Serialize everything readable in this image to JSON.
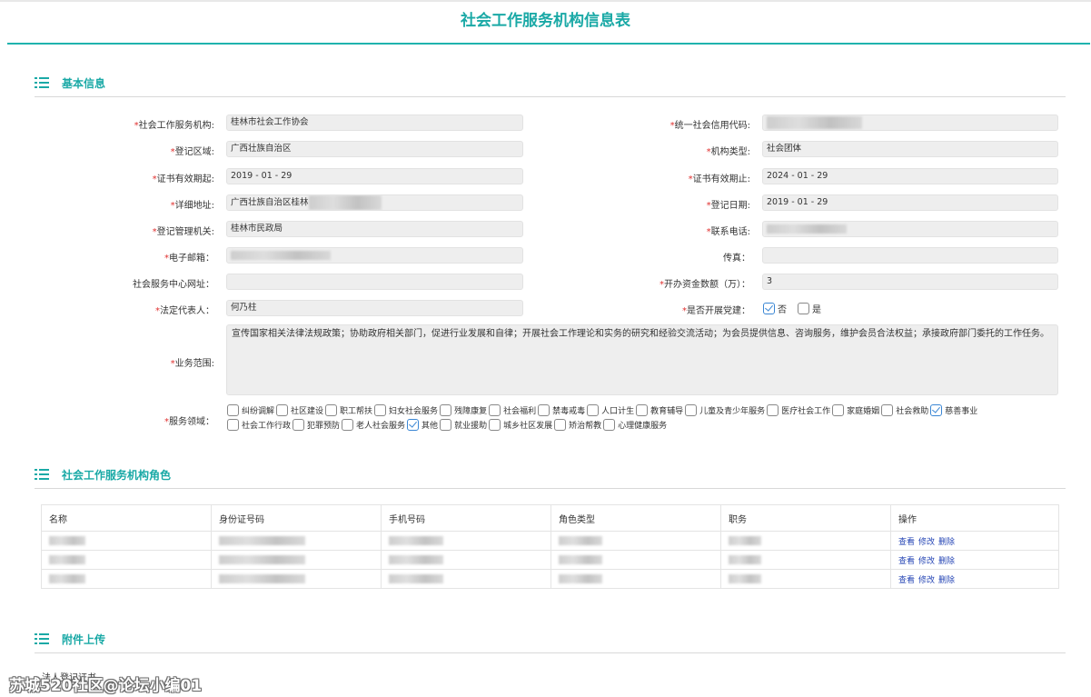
{
  "page": {
    "title": "社会工作服务机构信息表"
  },
  "sections": {
    "basic": "基本信息",
    "roles": "社会工作服务机构角色",
    "attachments": "附件上传"
  },
  "form": {
    "org_name": {
      "label": "社会工作服务机构:",
      "value": "桂林市社会工作协会"
    },
    "credit_code": {
      "label": "统一社会信用代码:",
      "value": ""
    },
    "region": {
      "label": "登记区域:",
      "value": "广西壮族自治区"
    },
    "org_type": {
      "label": "机构类型:",
      "value": "社会团体"
    },
    "cert_start": {
      "label": "证书有效期起:",
      "value": "2019 - 01 - 29"
    },
    "cert_end": {
      "label": "证书有效期止:",
      "value": "2024 - 01 - 29"
    },
    "address": {
      "label": "详细地址:",
      "value": "广西壮族自治区桂林"
    },
    "reg_date": {
      "label": "登记日期:",
      "value": "2019 - 01 - 29"
    },
    "authority": {
      "label": "登记管理机关:",
      "value": "桂林市民政局"
    },
    "phone": {
      "label": "联系电话:",
      "value": ""
    },
    "email": {
      "label": "电子邮箱：",
      "value": ""
    },
    "fax": {
      "label": "传真：",
      "value": ""
    },
    "website": {
      "label": "社会服务中心网址：",
      "value": ""
    },
    "capital": {
      "label": "开办资金数额（万）：",
      "value": "3"
    },
    "legal_rep": {
      "label": "法定代表人：",
      "value": "何乃柱"
    },
    "party": {
      "label": "是否开展党建：",
      "opt_no": "否",
      "opt_yes": "是",
      "selected": "否"
    },
    "scope": {
      "label": "业务范围:",
      "value": "宣传国家相关法律法规政策；协助政府相关部门，促进行业发展和自律；开展社会工作理论和实务的研究和经验交流活动；为会员提供信息、咨询服务，维护会员合法权益；承接政府部门委托的工作任务。"
    },
    "service_label": "服务领域：",
    "service_line1": [
      {
        "text": "纠纷调解",
        "checked": false
      },
      {
        "text": "社区建设",
        "checked": false
      },
      {
        "text": "职工帮扶",
        "checked": false
      },
      {
        "text": "妇女社会服务",
        "checked": false
      },
      {
        "text": "残障康复",
        "checked": false
      },
      {
        "text": "社会福利",
        "checked": false
      },
      {
        "text": "禁毒戒毒",
        "checked": false
      },
      {
        "text": "人口计生",
        "checked": false
      },
      {
        "text": "教育辅导",
        "checked": false
      },
      {
        "text": "儿童及青少年服务",
        "checked": false
      },
      {
        "text": "医疗社会工作",
        "checked": false
      },
      {
        "text": "家庭婚姻",
        "checked": false
      },
      {
        "text": "社会救助",
        "checked": false
      },
      {
        "text": "慈善事业",
        "checked": true
      }
    ],
    "service_line2": [
      {
        "text": "社会工作行政",
        "checked": false
      },
      {
        "text": "犯罪预防",
        "checked": false
      },
      {
        "text": "老人社会服务",
        "checked": false
      },
      {
        "text": "其他",
        "checked": true
      },
      {
        "text": "就业援助",
        "checked": false
      },
      {
        "text": "城乡社区发展",
        "checked": false
      },
      {
        "text": "矫治帮教",
        "checked": false
      },
      {
        "text": "心理健康服务",
        "checked": false
      }
    ]
  },
  "roles_table": {
    "headers": [
      "名称",
      "身份证号码",
      "手机号码",
      "角色类型",
      "职务",
      "操作"
    ],
    "actions": [
      "查看",
      "修改",
      "删除"
    ],
    "row_count": 3
  },
  "attachments_partial": "法人登记证书",
  "watermark": "苏城520社区@论坛小编01"
}
